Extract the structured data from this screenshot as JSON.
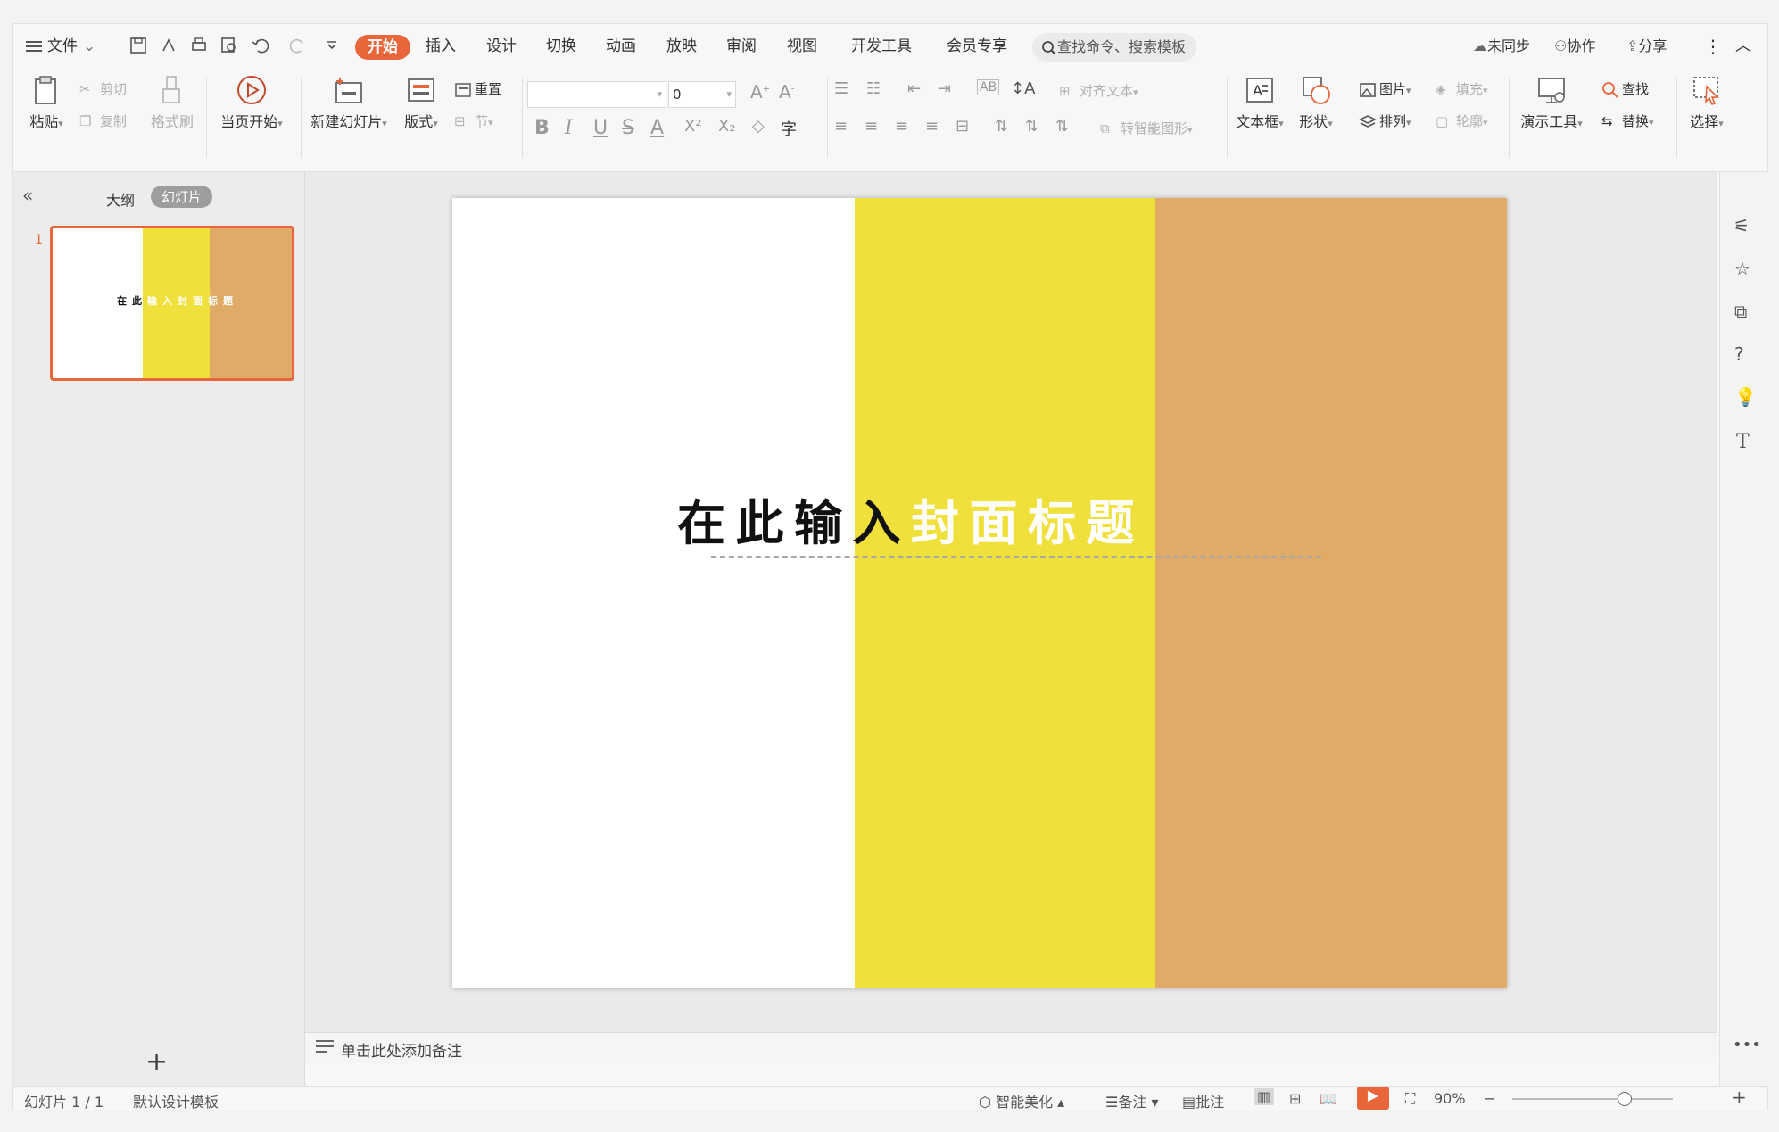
{
  "menubar": {
    "file": "文件",
    "tabs": [
      "开始",
      "插入",
      "设计",
      "切换",
      "动画",
      "放映",
      "审阅",
      "视图",
      "开发工具",
      "会员专享"
    ],
    "active_tab": "开始",
    "search_placeholder": "查找命令、搜索模板",
    "sync": "未同步",
    "collab": "协作",
    "share": "分享"
  },
  "ribbon": {
    "paste": "粘贴",
    "cut": "剪切",
    "copy": "复制",
    "format_painter": "格式刷",
    "play_current": "当页开始",
    "new_slide": "新建幻灯片",
    "layout": "版式",
    "reset": "重置",
    "section": "节",
    "font_size": "0",
    "align_text": "对齐文本",
    "convert_smartart": "转智能图形",
    "textbox": "文本框",
    "shape": "形状",
    "picture": "图片",
    "arrange": "排列",
    "fill": "填充",
    "outline": "轮廓",
    "present_tools": "演示工具",
    "find": "查找",
    "replace": "替换",
    "select": "选择"
  },
  "leftpane": {
    "outline_tab": "大纲",
    "slides_tab": "幻灯片",
    "slide_number": "1",
    "add_symbol": "+"
  },
  "slide": {
    "title_chars": [
      "在",
      "此",
      "输",
      "入",
      "封",
      "面",
      "标",
      "题"
    ],
    "colors": {
      "white": "#ffffff",
      "yellow": "#efe03c",
      "orange": "#e0ab66",
      "accent": "#e8663a"
    }
  },
  "notes_placeholder": "单击此处添加备注",
  "status": {
    "slide_info": "幻灯片 1 / 1",
    "template": "默认设计模板",
    "beautify": "智能美化",
    "notes": "备注",
    "comments": "批注",
    "zoom": "90%"
  }
}
